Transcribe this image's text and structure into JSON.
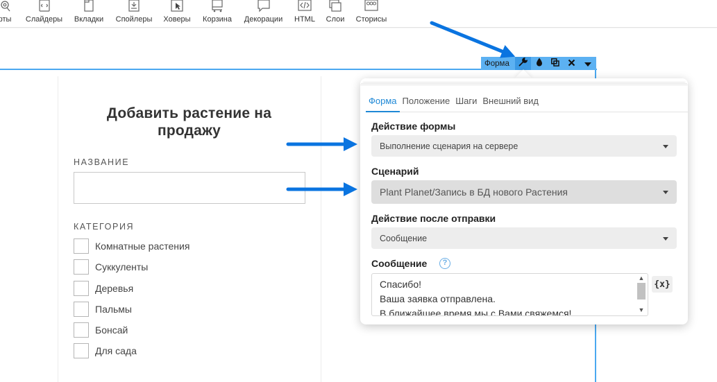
{
  "toolbar": {
    "items": [
      {
        "label": "рты",
        "icon": "map-pin-icon"
      },
      {
        "label": "Слайдеры",
        "icon": "slider-icon"
      },
      {
        "label": "Вкладки",
        "icon": "tabs-icon"
      },
      {
        "label": "Спойлеры",
        "icon": "spoiler-icon"
      },
      {
        "label": "Ховеры",
        "icon": "cursor-icon"
      },
      {
        "label": "Корзина",
        "icon": "cart-icon"
      },
      {
        "label": "Декорации",
        "icon": "speech-bubble-icon"
      },
      {
        "label": "HTML",
        "icon": "code-icon"
      },
      {
        "label": "Слои",
        "icon": "layers-icon"
      },
      {
        "label": "Сторисы",
        "icon": "stories-icon"
      }
    ]
  },
  "page_form": {
    "title_line1": "Добавить растение на",
    "title_line2": "продажу",
    "name_label": "НАЗВАНИЕ",
    "category_label": "КАТЕГОРИЯ",
    "categories": [
      "Комнатные растения",
      "Суккуленты",
      "Деревья",
      "Пальмы",
      "Бонсай",
      "Для сада"
    ]
  },
  "selection_bar": {
    "label": "Форма"
  },
  "popup": {
    "tabs": [
      "Форма",
      "Положение",
      "Шаги",
      "Внешний вид"
    ],
    "active_tab": "Форма",
    "form_action_label": "Действие формы",
    "form_action_value": "Выполнение сценария на сервере",
    "scenario_label": "Сценарий",
    "scenario_value": "Plant Planet/Запись в БД нового Растения",
    "after_submit_label": "Действие после отправки",
    "after_submit_value": "Сообщение",
    "message_label": "Сообщение",
    "message_lines": [
      "Спасибо!",
      "Ваша заявка отправлена.",
      "В ближайшее время мы с Вами свяжемся!"
    ],
    "variable_button": "{x}",
    "help_glyph": "?"
  },
  "colors": {
    "accent": "#1e88d6",
    "selection": "#5cb1f2",
    "arrow": "#0a74e0"
  }
}
